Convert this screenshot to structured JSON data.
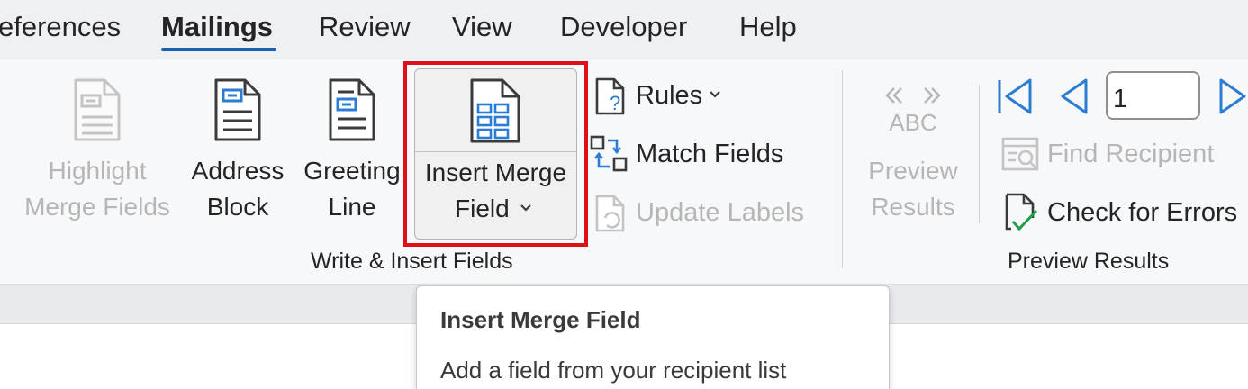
{
  "tabs": [
    {
      "label": "eferences"
    },
    {
      "label": "Mailings",
      "active": true
    },
    {
      "label": "Review"
    },
    {
      "label": "View"
    },
    {
      "label": "Developer"
    },
    {
      "label": "Help"
    }
  ],
  "write_insert": {
    "highlight": {
      "line1": "Highlight",
      "line2": "Merge Fields",
      "icon": "highlight-merge-fields-icon",
      "disabled": true
    },
    "address_block": {
      "line1": "Address",
      "line2": "Block",
      "icon": "address-block-icon"
    },
    "greeting_line": {
      "line1": "Greeting",
      "line2": "Line",
      "icon": "greeting-line-icon"
    },
    "insert_merge_field": {
      "line1": "Insert Merge",
      "line2": "Field",
      "icon": "insert-merge-field-icon",
      "highlighted": true
    },
    "rules": {
      "label": "Rules",
      "icon": "rules-icon"
    },
    "match_fields": {
      "label": "Match Fields",
      "icon": "match-fields-icon"
    },
    "update_labels": {
      "label": "Update Labels",
      "icon": "update-labels-icon",
      "disabled": true
    },
    "group_label": "Write & Insert Fields"
  },
  "preview": {
    "preview_results": {
      "icon_text": "ABC",
      "line1": "Preview",
      "line2": "Results",
      "icon": "preview-results-icon",
      "disabled": true
    },
    "record_number": "1",
    "find_recipient": {
      "label": "Find Recipient",
      "icon": "find-recipient-icon",
      "disabled": true
    },
    "check_errors": {
      "label": "Check for Errors",
      "icon": "check-for-errors-icon"
    },
    "group_label": "Preview Results"
  },
  "tooltip": {
    "title": "Insert Merge Field",
    "description": "Add a field from your recipient list"
  },
  "colors": {
    "accent": "#1b5eab",
    "highlight_frame": "#e0101a",
    "icon_blue": "#2b7cd3"
  }
}
